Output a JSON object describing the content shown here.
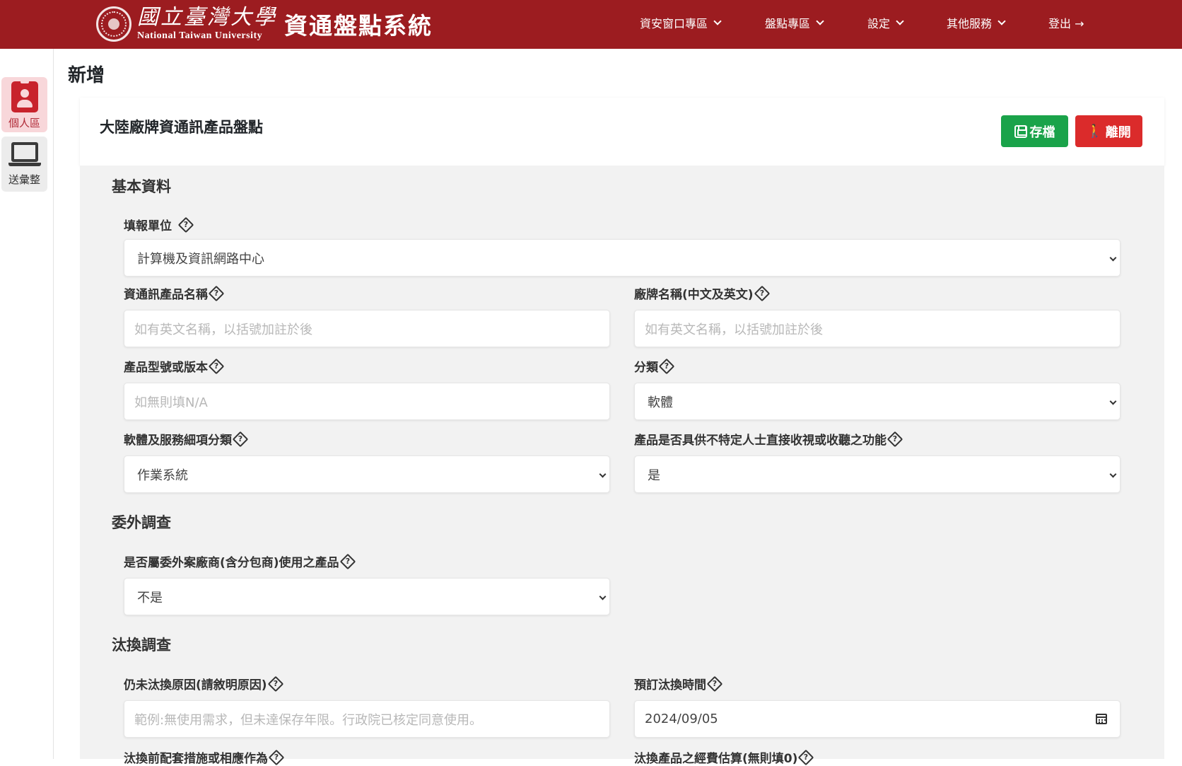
{
  "navbar": {
    "logo_icon": "ntu-seal-icon",
    "university_cn": "國立臺灣大學",
    "university_en": "National Taiwan University",
    "system_title": "資通盤點系統",
    "menu": [
      {
        "label": "資安窗口專區"
      },
      {
        "label": "盤點專區"
      },
      {
        "label": "設定"
      },
      {
        "label": "其他服務"
      },
      {
        "label": "登出 →"
      }
    ],
    "bg_color": "#9c1c20"
  },
  "sidebar": {
    "items": [
      {
        "label": "個人區",
        "icon": "id-badge-icon",
        "active": true
      },
      {
        "label": "送彙整",
        "icon": "laptop-icon",
        "active": false
      }
    ]
  },
  "page": {
    "title": "新增",
    "card_title": "大陸廠牌資通訊產品盤點",
    "save_label": "存檔",
    "leave_label": "離開"
  },
  "sections": {
    "basic": "基本資料",
    "outsourcing": "委外調查",
    "replacement": "汰換調查"
  },
  "fields": {
    "unit": {
      "label": "填報單位",
      "value": "計算機及資訊網路中心"
    },
    "product_name": {
      "label": "資通訊產品名稱",
      "placeholder": "如有英文名稱，以括號加註於後"
    },
    "brand_name": {
      "label": "廠牌名稱(中文及英文)",
      "placeholder": "如有英文名稱，以括號加註於後"
    },
    "model": {
      "label": "產品型號或版本",
      "placeholder": "如無則填N/A"
    },
    "category": {
      "label": "分類",
      "value": "軟體"
    },
    "sub_category": {
      "label": "軟體及服務細項分類",
      "value": "作業系統"
    },
    "broadcast": {
      "label": "產品是否具供不特定人士直接收視或收聽之功能",
      "value": "是"
    },
    "outsourced": {
      "label": "是否屬委外案廠商(含分包商)使用之產品",
      "value": "不是"
    },
    "not_replaced_reason": {
      "label": "仍未汰換原因(請敘明原因)",
      "placeholder": "範例:無使用需求，但未達保存年限。行政院已核定同意使用。"
    },
    "planned_date": {
      "label": "預訂汰換時間",
      "value": "2024/09/05"
    },
    "measures": {
      "label": "汰換前配套措施或相應作為"
    },
    "budget": {
      "label": "汰換產品之經費估算(無則填0)"
    }
  }
}
